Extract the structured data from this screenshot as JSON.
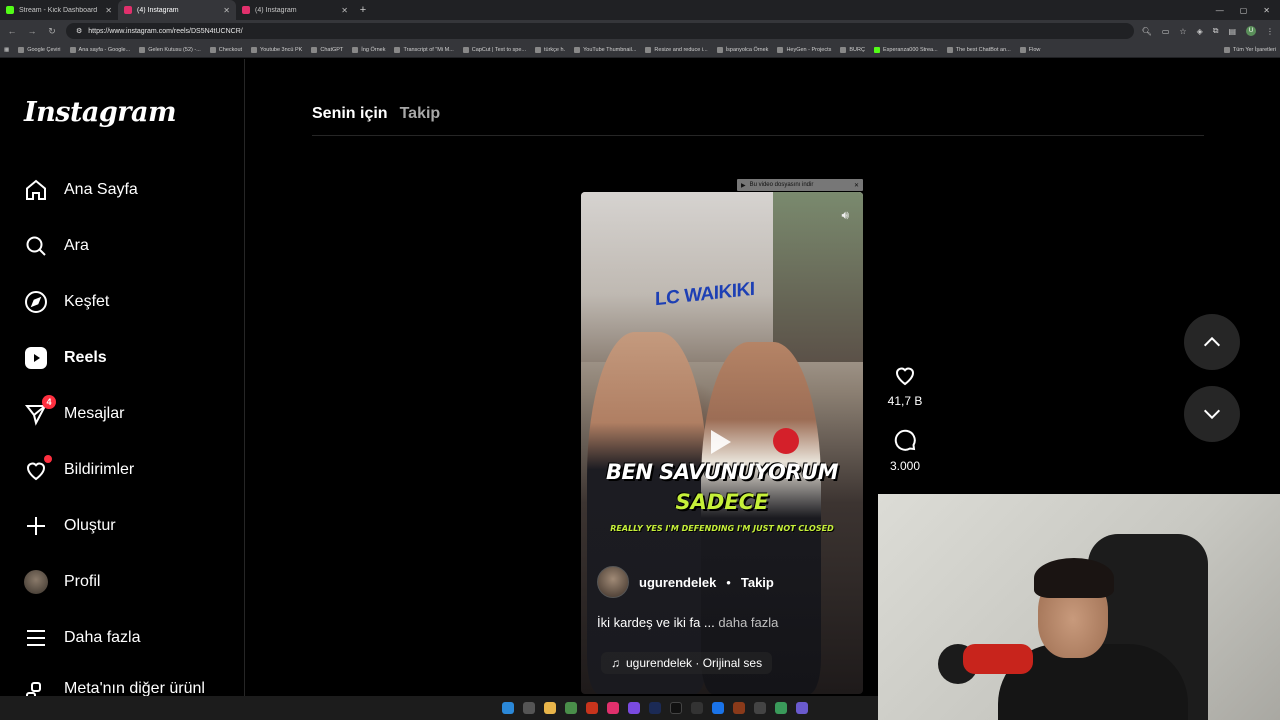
{
  "browser": {
    "tabs": [
      {
        "title": "Stream - Kick Dashboard",
        "color": "#53fc18",
        "active": false
      },
      {
        "title": "(4) Instagram",
        "color": "#e1306c",
        "active": true
      },
      {
        "title": "(4) Instagram",
        "color": "#e1306c",
        "active": false
      }
    ],
    "new_tab": "+",
    "url": "https://www.instagram.com/reels/DS5N4tUCNCR/",
    "bookmarks": [
      "Google Çeviri",
      "Ana sayfa - Google...",
      "Gelen Kutusu (52) -...",
      "Checkout",
      "Youtube 3ncü PK",
      "ChatGPT",
      "İng Örnek",
      "Transcript of \"Mi M...",
      "CapCut | Text to spe...",
      "türkçe h.",
      "YouTube Thumbnail...",
      "Resize and reduce i...",
      "İspanyolca Örnek",
      "HeyGen - Projects",
      "BURÇ",
      "Esperanza000 Strea...",
      "The best ChatBot an...",
      "Flow"
    ],
    "bookmarks_right": "Tüm Yer İşaretleri"
  },
  "sidebar": {
    "logo": "Instagram",
    "items": [
      {
        "label": "Ana Sayfa",
        "icon": "home-icon"
      },
      {
        "label": "Ara",
        "icon": "search-icon"
      },
      {
        "label": "Keşfet",
        "icon": "compass-icon"
      },
      {
        "label": "Reels",
        "icon": "reels-icon",
        "active": true
      },
      {
        "label": "Mesajlar",
        "icon": "messenger-icon",
        "badge": "4"
      },
      {
        "label": "Bildirimler",
        "icon": "heart-icon"
      },
      {
        "label": "Oluştur",
        "icon": "plus-icon"
      },
      {
        "label": "Profil",
        "icon": "avatar"
      },
      {
        "label": "Daha fazla",
        "icon": "menu-icon"
      },
      {
        "label": "Meta'nın diğer ürünl",
        "icon": "meta-icon"
      }
    ]
  },
  "main": {
    "tabs": [
      "Senin için",
      "Takip"
    ],
    "download_bar": "Bu video dosyasını indir"
  },
  "reel": {
    "caption_line1": "BEN SAVUNUYORUM",
    "caption_line2": "SADECE",
    "caption_line3": "REALLY YES I'M DEFENDING I'M JUST NOT CLOSED",
    "store_sign": "LC WAIKIKI",
    "username": "ugurendelek",
    "dot": "•",
    "follow": "Takip",
    "description": "İki kardeş ve iki fa ...",
    "more": "daha fazla",
    "audio": "ugurendelek · Orijinal ses",
    "likes": "41,7 B",
    "comments": "3.000"
  },
  "colors": {
    "background": "#000000",
    "badge": "#ff3040",
    "caption_accent": "#c6f03a",
    "inactive_text": "#a8a8a8"
  }
}
